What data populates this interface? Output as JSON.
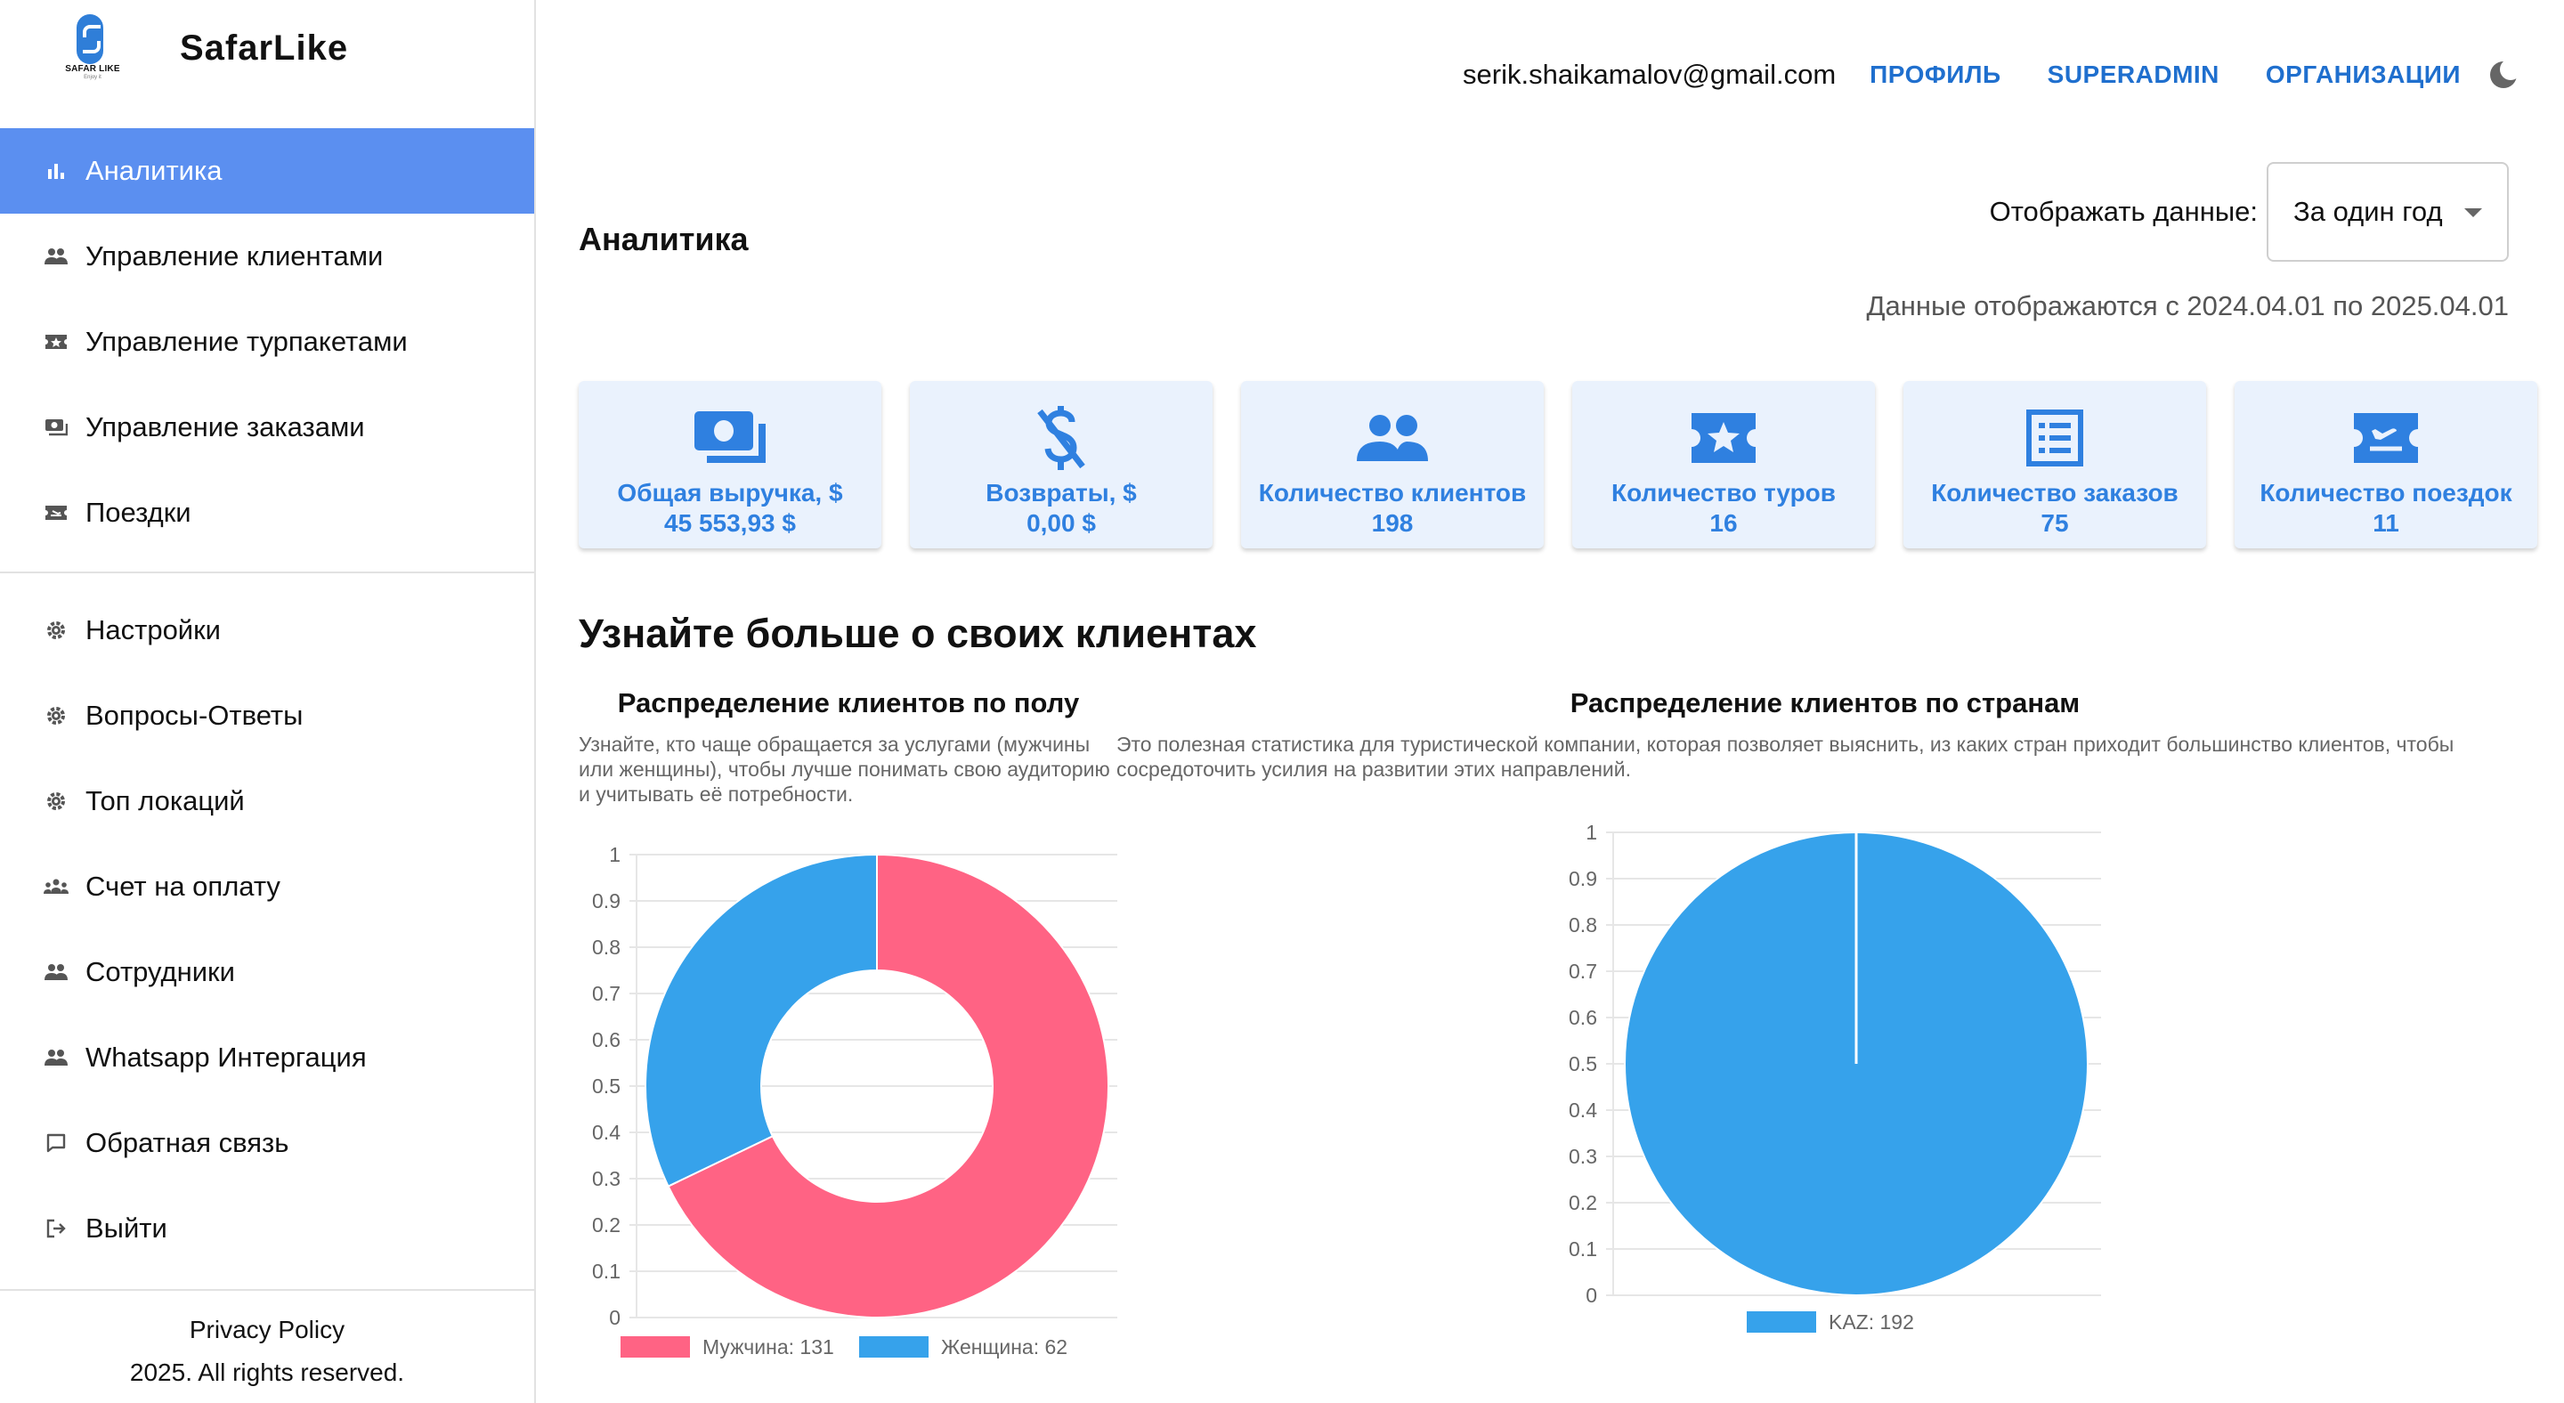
{
  "sidebar": {
    "logo_tag": "SAFAR LIKE",
    "logo_sub": "Enjoy it",
    "brand": "SafarLike",
    "main_items": [
      {
        "label": "Аналитика",
        "icon": "bar-chart-icon",
        "active": true
      },
      {
        "label": "Управление клиентами",
        "icon": "people-icon"
      },
      {
        "label": "Управление турпакетами",
        "icon": "ticket-star-icon"
      },
      {
        "label": "Управление заказами",
        "icon": "money-icon"
      },
      {
        "label": "Поездки",
        "icon": "plane-ticket-icon"
      }
    ],
    "secondary_items": [
      {
        "label": "Настройки",
        "icon": "gear-icon"
      },
      {
        "label": "Вопросы-Ответы",
        "icon": "gear-icon"
      },
      {
        "label": "Топ локаций",
        "icon": "gear-icon"
      },
      {
        "label": "Счет на оплату",
        "icon": "groups-icon"
      },
      {
        "label": "Сотрудники",
        "icon": "people-icon"
      },
      {
        "label": "Whatsapp Интергация",
        "icon": "people-icon"
      },
      {
        "label": "Обратная связь",
        "icon": "feedback-icon"
      },
      {
        "label": "Выйти",
        "icon": "logout-icon"
      }
    ],
    "footer_link": "Privacy Policy",
    "footer_copy": "2025. All rights reserved."
  },
  "header": {
    "email": "serik.shaikamalov@gmail.com",
    "links": [
      "Профиль",
      "Superadmin",
      "Организации"
    ],
    "theme_icon": "moon-icon"
  },
  "main": {
    "title": "Аналитика",
    "period_label": "Отображать данные:",
    "period_value": "За один год",
    "range_text": "Данные отображаются с 2024.04.01 по 2025.04.01",
    "cards": [
      {
        "label": "Общая выручка, $",
        "value": "45 553,93 $",
        "icon": "payments-icon"
      },
      {
        "label": "Возвраты, $",
        "value": "0,00 $",
        "icon": "money-off-icon"
      },
      {
        "label": "Количество клиентов",
        "value": "198",
        "icon": "people-icon"
      },
      {
        "label": "Количество туров",
        "value": "16",
        "icon": "ticket-star-icon"
      },
      {
        "label": "Количество заказов",
        "value": "75",
        "icon": "list-icon"
      },
      {
        "label": "Количество поездок",
        "value": "11",
        "icon": "plane-ticket-icon"
      }
    ],
    "section_title": "Узнайте больше о своих клиентах",
    "accent_color": "#2f80e0"
  },
  "chart_data": [
    {
      "type": "pie",
      "variant": "doughnut",
      "title": "Распределение клиентов по полу",
      "description": "Узнайте, кто чаще обращается за услугами (мужчины или женщины), чтобы лучше понимать свою аудиторию и учитывать её потребности.",
      "ylim": [
        0,
        1
      ],
      "yticks": [
        "0",
        "0.1",
        "0.2",
        "0.3",
        "0.4",
        "0.5",
        "0.6",
        "0.7",
        "0.8",
        "0.9",
        "1"
      ],
      "grid": true,
      "legend": "bottom",
      "slices": [
        {
          "label": "Мужчина: 131",
          "value": 131,
          "color": "#ff6384"
        },
        {
          "label": "Женщина: 62",
          "value": 62,
          "color": "#36a2eb"
        }
      ]
    },
    {
      "type": "pie",
      "title": "Распределение клиентов по странам",
      "description": "Это полезная статистика для туристической компании, которая позволяет выяснить, из каких стран приходит большинство клиентов, чтобы сосредоточить усилия на развитии этих направлений.",
      "ylim": [
        0,
        1
      ],
      "yticks": [
        "0",
        "0.1",
        "0.2",
        "0.3",
        "0.4",
        "0.5",
        "0.6",
        "0.7",
        "0.8",
        "0.9",
        "1"
      ],
      "grid": true,
      "legend": "bottom",
      "slices": [
        {
          "label": "KAZ: 192",
          "value": 192,
          "color": "#36a2eb"
        }
      ]
    }
  ]
}
